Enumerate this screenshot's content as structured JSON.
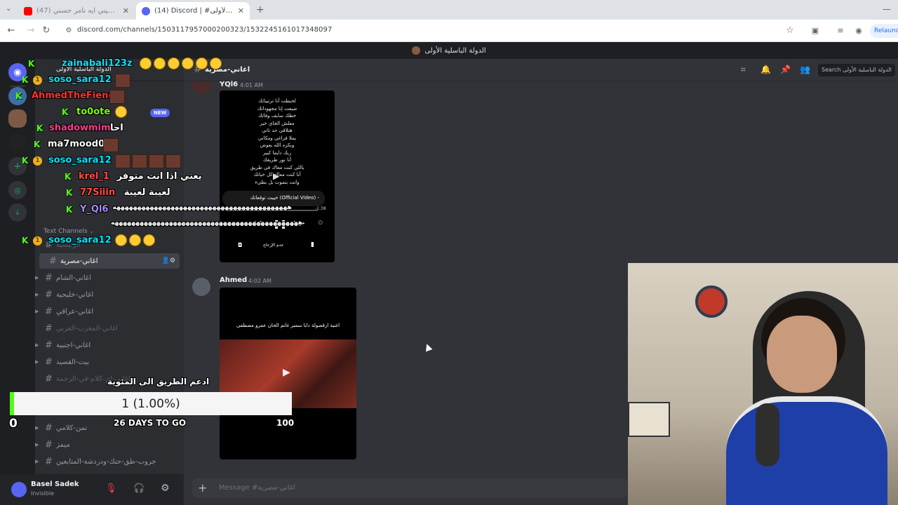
{
  "browser": {
    "tabs": [
      {
        "label": "(47) ناسيني ايه نامر حسني - YouTube",
        "active": false
      },
      {
        "label": "(14) Discord | #اغاني-مصرية | الدولة الباسلية الأولى",
        "active": true
      }
    ],
    "url": "discord.com/channels/1503117957000200323/1532245161017348097",
    "relaunch_label": "Relaunch"
  },
  "server": {
    "title": "الدولة الباسلية الأولى",
    "name": "الدولة الباسلية الأولى"
  },
  "channel_list": {
    "new_badge": "NEW",
    "category": "Text Channels",
    "channels": [
      {
        "name": "الرئيسية",
        "state": "muted",
        "arrow": false
      },
      {
        "name": "اغاني-مصرية",
        "state": "selected",
        "arrow": false
      },
      {
        "name": "اغاني-الشام",
        "state": "normal",
        "arrow": true
      },
      {
        "name": "اغاني-خليجية",
        "state": "normal",
        "arrow": true
      },
      {
        "name": "اغاني-عراقي",
        "state": "normal",
        "arrow": true
      },
      {
        "name": "اغاني-المغرب-العربي",
        "state": "muted",
        "arrow": false
      },
      {
        "name": "اغاني-اجنبية",
        "state": "normal",
        "arrow": true
      },
      {
        "name": "بيت-القصيد",
        "state": "normal",
        "arrow": true
      },
      {
        "name": "اغاني-اي-كلام-في-الزحمة",
        "state": "muted",
        "arrow": false
      },
      {
        "name": "تمن-كلامي",
        "state": "normal",
        "arrow": true
      },
      {
        "name": "ميمز",
        "state": "normal",
        "arrow": true
      },
      {
        "name": "جروب-طق-حنك-ودردشة-المتابعين",
        "state": "normal",
        "arrow": true
      }
    ]
  },
  "user": {
    "name": "Basel Sadek",
    "status": "Invisible"
  },
  "main": {
    "channel_name": "اغاني-مصرية",
    "search_placeholder": "Search الدولة الباسلية الأولى",
    "messages": [
      {
        "author": "YQl6",
        "time": "4:01 AM",
        "video_lines": [
          "لخبطت أنا ترتيباتك",
          "ضيعت إنا مجهوداتك",
          "خطك سايف وفاتك",
          "معلش الجاي خير",
          "هتلاقي حد تاني",
          "يملا فراغي ومكاني",
          "وبكره الله يعوض",
          "ربك دايما كبير",
          "أنا نور طريقك",
          "ياللي كنت معاك في طريق",
          "أنا كنت معاك كل حياتك",
          "وانت بتموت بل بطيء"
        ],
        "player_title": "خيبت توقعاتك (Official Video) -",
        "player_left": "عدم الإزعاج",
        "player_time": "-1:38"
      },
      {
        "author": "Ahmed",
        "time": "4:02 AM",
        "video_title": "اغنية ارقصولة دابا سمير غانم الحان عمرو مصطفى"
      }
    ],
    "input_placeholder": "Message #اغاني-مصرية"
  },
  "stream_overlay": {
    "chat": [
      {
        "user": "zainabali123z",
        "user_color": "#00e5ff",
        "text": "",
        "emotes": "laugh6"
      },
      {
        "user": "soso_sara12",
        "user_color": "#00e5ff",
        "text": "",
        "emotes": "cat1"
      },
      {
        "user": "AhmedTheFiend",
        "user_color": "#ff3030",
        "text": "",
        "emotes": "cat1"
      },
      {
        "user": "to0ote",
        "user_color": "#7fff00",
        "text": "",
        "emotes": "laugh1"
      },
      {
        "user": "shadowmimi",
        "user_color": "#ff3a8c",
        "text": "احا",
        "emotes": ""
      },
      {
        "user": "ma7mood04",
        "user_color": "#ffffff",
        "text": "",
        "emotes": "cat1"
      },
      {
        "user": "soso_sara12",
        "user_color": "#00e5ff",
        "text": "",
        "emotes": "cat4"
      },
      {
        "user": "krel_1",
        "user_color": "#ff4a4a",
        "text": "يعني اذا انت متوفر",
        "emotes": ""
      },
      {
        "user": "77Siiin",
        "user_color": "#ff4a4a",
        "text": "لعيبة لعيبة",
        "emotes": ""
      },
      {
        "user": "Y_Ql6",
        "user_color": "#a78bfa",
        "text": "ههههههههههههههههههههههههههههههههههههههههههه",
        "emotes": ""
      },
      {
        "user": "",
        "user_color": "#ffffff",
        "text": "هههههههههههههههههههههههههههههههههههههههههههههه",
        "emotes": ""
      },
      {
        "user": "soso_sara12",
        "user_color": "#00e5ff",
        "text": "",
        "emotes": "face3"
      }
    ],
    "goal_title": "ادعم الطريق الى المئوية",
    "goal_value": "1 (1.00%)",
    "goal_progress": 0.01,
    "goal_left": "0",
    "goal_right": "100",
    "days_left": "26 DAYS TO GO"
  },
  "colors": {
    "discord_bg": "#313338",
    "sidebar_bg": "#2b2d31",
    "rail_bg": "#1e1f22",
    "kick_green": "#53fc18",
    "new_badge": "#5865f2"
  }
}
